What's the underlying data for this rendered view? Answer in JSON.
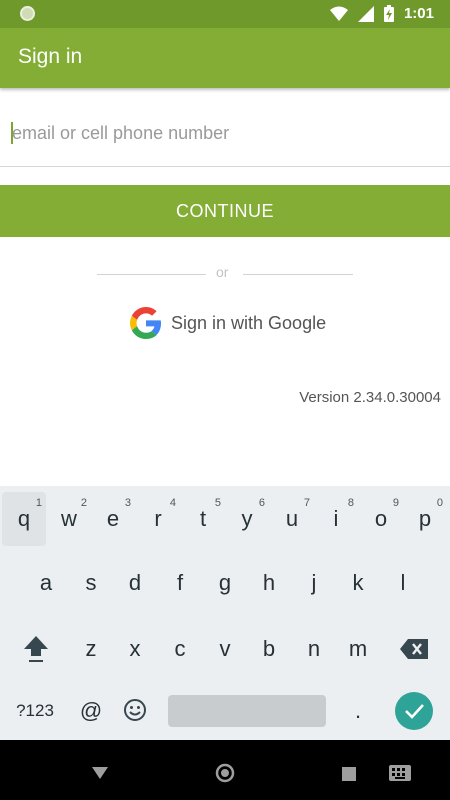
{
  "status_bar": {
    "time": "1:01"
  },
  "app_bar": {
    "title": "Sign in"
  },
  "form": {
    "email_placeholder": "email or cell phone number",
    "email_value": "",
    "continue_label": "CONTINUE",
    "or_label": "or",
    "google_label": "Sign in with Google"
  },
  "version": "Version 2.34.0.30004",
  "keyboard": {
    "row1": [
      "q",
      "w",
      "e",
      "r",
      "t",
      "y",
      "u",
      "i",
      "o",
      "p"
    ],
    "row1_hints": [
      "1",
      "2",
      "3",
      "4",
      "5",
      "6",
      "7",
      "8",
      "9",
      "0"
    ],
    "row2": [
      "a",
      "s",
      "d",
      "f",
      "g",
      "h",
      "j",
      "k",
      "l"
    ],
    "row3": [
      "z",
      "x",
      "c",
      "v",
      "b",
      "n",
      "m"
    ],
    "symbols_label": "?123",
    "at_label": "@",
    "period_label": "."
  },
  "colors": {
    "brand_green": "#83ad35",
    "status_green": "#6f9a2b",
    "enter_teal": "#2ea397"
  }
}
